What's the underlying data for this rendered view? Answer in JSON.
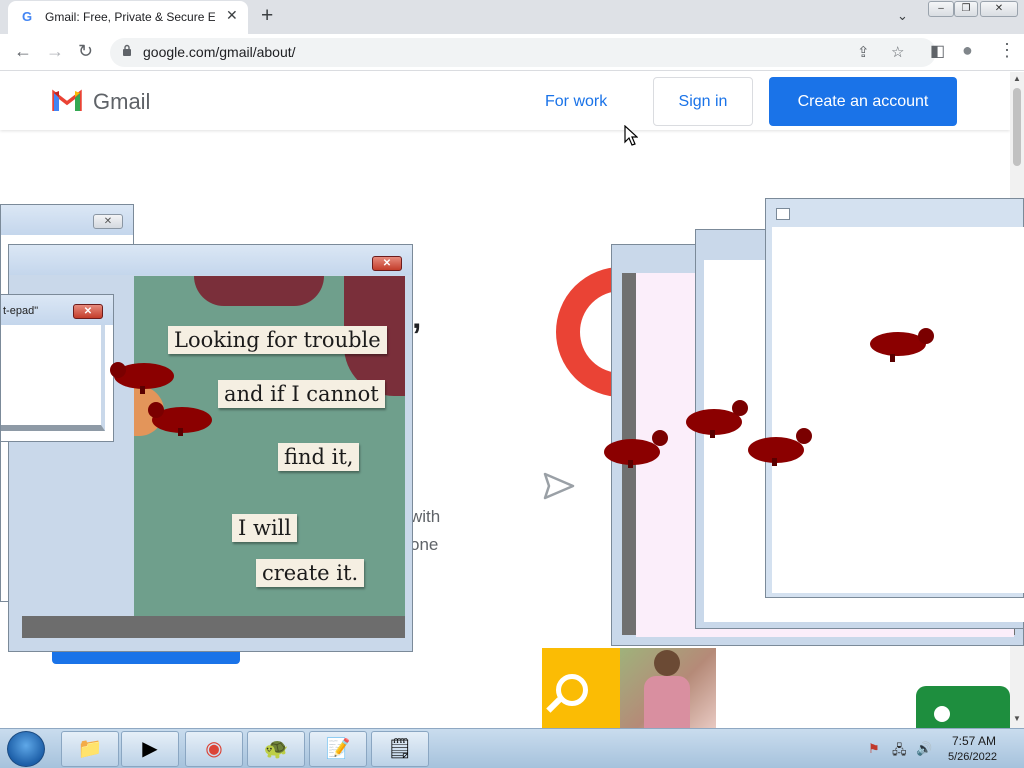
{
  "browser": {
    "tab": {
      "favicon": "G",
      "title": "Gmail: Free, Private & Secure Email",
      "close": "✕"
    },
    "new_tab": "+",
    "tab_search": "⌄",
    "window_buttons": {
      "minimize": "–",
      "restore": "❐",
      "close": "✕"
    },
    "nav": {
      "back": "←",
      "forward": "→",
      "reload": "↻"
    },
    "url": "google.com/gmail/about/",
    "toolbar_icons": {
      "share": "⇪",
      "star": "☆",
      "side_panel": "◧",
      "profile": "●",
      "menu": "⋮"
    }
  },
  "gmail": {
    "logo_word": "Gmail",
    "nav": {
      "for_work": "For work",
      "sign_in": "Sign in",
      "create_account": "Create an account"
    },
    "hero_fragments": {
      "comma": "’",
      "with": "with",
      "one": "one"
    }
  },
  "overlays": {
    "notepad_title": "t-epad\"",
    "close_glyph": "✕",
    "poster_lines": [
      "Looking for trouble",
      "and if I cannot",
      "find it,",
      "I will",
      "create it."
    ]
  },
  "scrollbar": {
    "up": "▲",
    "down": "▼"
  },
  "taskbar": {
    "items": [
      {
        "name": "explorer",
        "glyph": "📁"
      },
      {
        "name": "media-player",
        "glyph": "▶"
      },
      {
        "name": "chrome",
        "glyph": "◉"
      },
      {
        "name": "app-turtle",
        "glyph": "🐢"
      },
      {
        "name": "app-notepad-edit",
        "glyph": "📝"
      },
      {
        "name": "app-notepad",
        "glyph": "🗒"
      }
    ],
    "tray": {
      "flag": "⚑",
      "network": "🖧",
      "volume": "🔊"
    },
    "time": "7:57 AM",
    "date": "5/26/2022"
  },
  "colors": {
    "google_blue": "#1a73e8",
    "gmail_red": "#ea4335",
    "bird_red": "#8b0000"
  }
}
